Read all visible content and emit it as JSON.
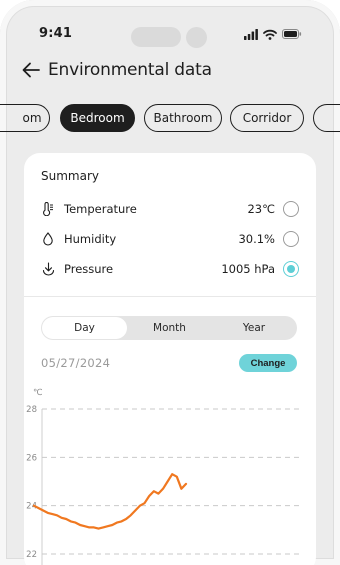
{
  "status_bar": {
    "time": "9:41"
  },
  "header": {
    "title": "Environmental data"
  },
  "rooms": [
    {
      "label": "om",
      "active": false
    },
    {
      "label": "Bedroom",
      "active": true
    },
    {
      "label": "Bathroom",
      "active": false
    },
    {
      "label": "Corridor",
      "active": false
    }
  ],
  "summary": {
    "title": "Summary",
    "rows": [
      {
        "label": "Temperature",
        "value": "23℃",
        "icon": "thermometer-icon",
        "selected": false
      },
      {
        "label": "Humidity",
        "value": "30.1%",
        "icon": "droplet-icon",
        "selected": false
      },
      {
        "label": "Pressure",
        "value": "1005 hPa",
        "icon": "pressure-icon",
        "selected": true
      }
    ]
  },
  "period_tabs": [
    {
      "label": "Day",
      "active": true
    },
    {
      "label": "Month",
      "active": false
    },
    {
      "label": "Year",
      "active": false
    }
  ],
  "date": "05/27/2024",
  "change_label": "Change",
  "colors": {
    "accent": "#6fd3d9",
    "line": "#f07820",
    "chip_active": "#1e1e1e"
  },
  "chart_data": {
    "type": "line",
    "ylabel": "℃",
    "yticks": [
      28,
      26,
      24,
      22
    ],
    "ylim": [
      22,
      28
    ],
    "grid": true,
    "series": [
      {
        "values": [
          24.0,
          23.9,
          23.8,
          23.7,
          23.65,
          23.6,
          23.5,
          23.45,
          23.35,
          23.3,
          23.2,
          23.15,
          23.1,
          23.1,
          23.05,
          23.1,
          23.15,
          23.2,
          23.3,
          23.35,
          23.45,
          23.6,
          23.8,
          24.0,
          24.1,
          24.4,
          24.6,
          24.5,
          24.7,
          25.0,
          25.3,
          25.2,
          24.7,
          24.9
        ]
      }
    ]
  }
}
